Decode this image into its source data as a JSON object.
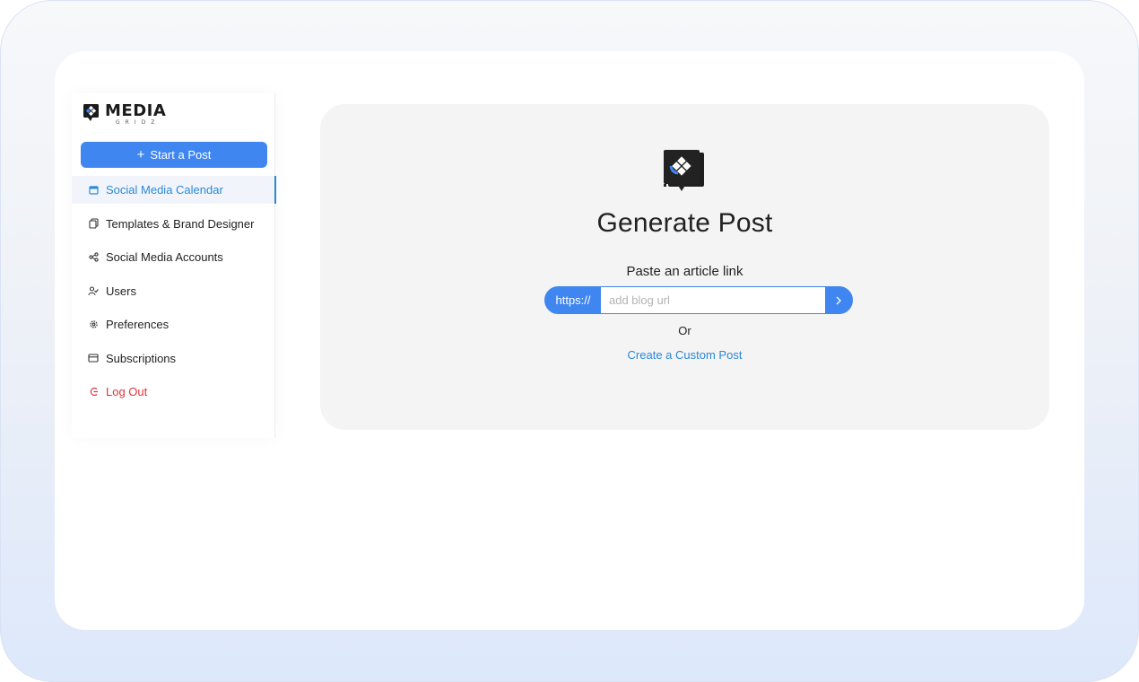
{
  "brand": {
    "name": "MEDIA",
    "tagline": "GRIDZ"
  },
  "sidebar": {
    "start_button": "Start a Post",
    "items": [
      {
        "label": "Social Media Calendar",
        "icon": "calendar-icon",
        "active": true
      },
      {
        "label": "Templates & Brand Designer",
        "icon": "templates-icon"
      },
      {
        "label": "Social Media Accounts",
        "icon": "share-icon"
      },
      {
        "label": "Users",
        "icon": "users-icon"
      },
      {
        "label": "Preferences",
        "icon": "gear-icon"
      },
      {
        "label": "Subscriptions",
        "icon": "card-icon"
      },
      {
        "label": "Log Out",
        "icon": "logout-icon"
      }
    ]
  },
  "main": {
    "title": "Generate Post",
    "subtitle": "Paste an article link",
    "url_prefix": "https://",
    "url_placeholder": "add blog url",
    "url_value": "",
    "submit_icon": "chevron-right-icon",
    "or_text": "Or",
    "custom_link": "Create a Custom Post"
  },
  "colors": {
    "accent": "#3f86f1",
    "link": "#2b88d8",
    "danger": "#e0323a",
    "card_bg": "#f4f4f4"
  }
}
